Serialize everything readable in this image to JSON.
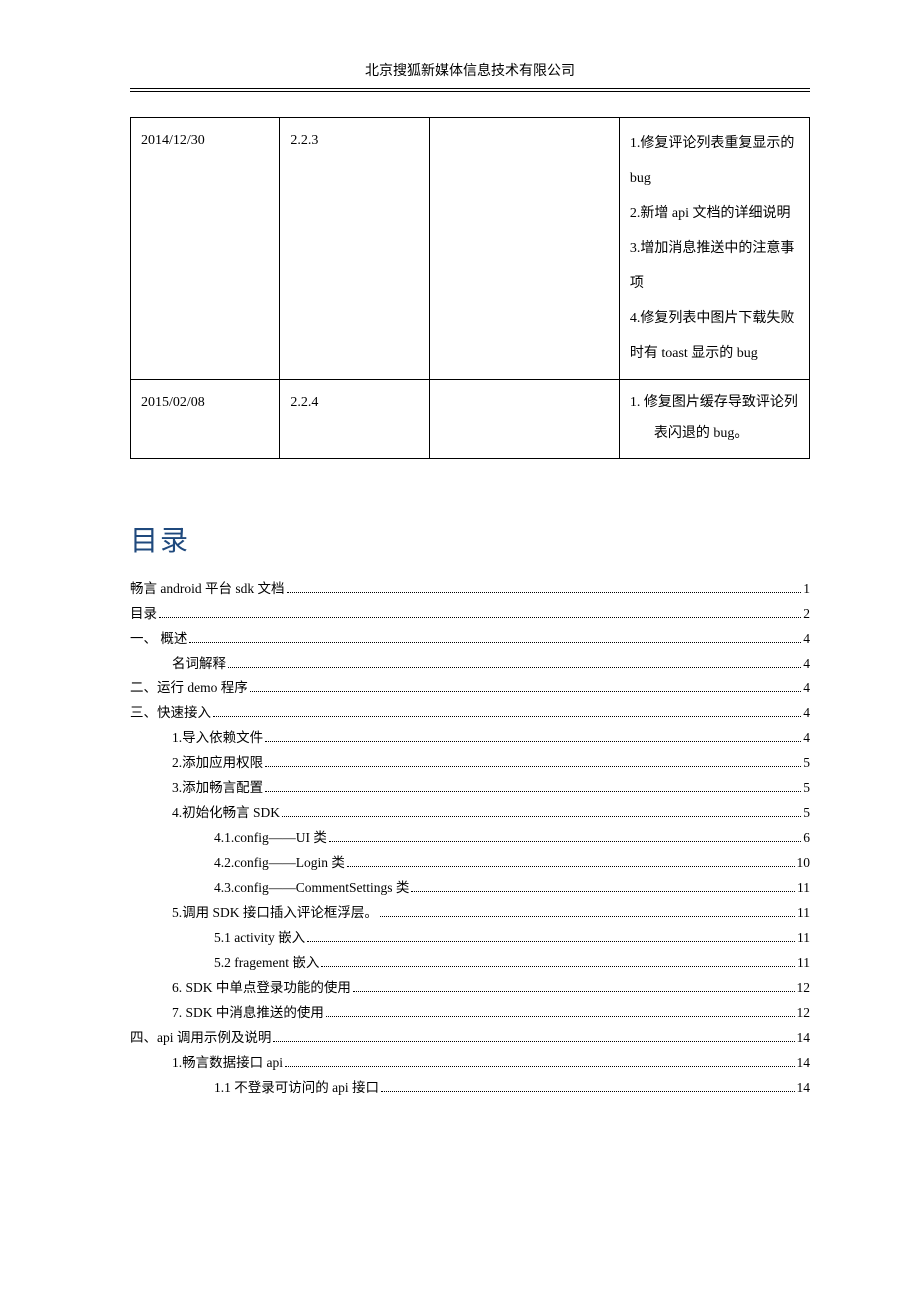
{
  "header": {
    "company": "北京搜狐新媒体信息技术有限公司"
  },
  "table": {
    "rows": [
      {
        "date": "2014/12/30",
        "version": "2.2.3",
        "col3": "",
        "notes": [
          "1.修复评论列表重复显示的 bug",
          "2.新增 api 文档的详细说明",
          "3.增加消息推送中的注意事项",
          "4.修复列表中图片下载失败时有 toast 显示的 bug"
        ],
        "ordered": false
      },
      {
        "date": "2015/02/08",
        "version": "2.2.4",
        "col3": "",
        "notes": [
          "修复图片缓存导致评论列表闪退的 bug。"
        ],
        "ordered": true
      }
    ]
  },
  "toc": {
    "title": "目录",
    "items": [
      {
        "label": "畅言 android 平台 sdk 文档",
        "page": "1",
        "indent": 0
      },
      {
        "label": "目录",
        "page": "2",
        "indent": 0
      },
      {
        "label": "一、 概述",
        "page": "4",
        "indent": 0
      },
      {
        "label": "名词解释",
        "page": "4",
        "indent": 1
      },
      {
        "label": "二、运行 demo 程序",
        "page": "4",
        "indent": 0
      },
      {
        "label": "三、快速接入",
        "page": "4",
        "indent": 0
      },
      {
        "label": "1.导入依赖文件",
        "page": "4",
        "indent": 1
      },
      {
        "label": "2.添加应用权限",
        "page": "5",
        "indent": 1
      },
      {
        "label": "3.添加畅言配置",
        "page": "5",
        "indent": 1
      },
      {
        "label": "4.初始化畅言 SDK",
        "page": "5",
        "indent": 1
      },
      {
        "label": "4.1.config——UI 类",
        "page": "6",
        "indent": 2
      },
      {
        "label": "4.2.config——Login 类",
        "page": "10",
        "indent": 2
      },
      {
        "label": "4.3.config——CommentSettings 类",
        "page": "11",
        "indent": 2
      },
      {
        "label": "5.调用 SDK 接口插入评论框浮层。",
        "page": "11",
        "indent": 1
      },
      {
        "label": "5.1 activity 嵌入",
        "page": "11",
        "indent": 2
      },
      {
        "label": "5.2 fragement 嵌入",
        "page": "11",
        "indent": 2
      },
      {
        "label": "6. SDK 中单点登录功能的使用",
        "page": "12",
        "indent": 1
      },
      {
        "label": "7. SDK 中消息推送的使用",
        "page": "12",
        "indent": 1
      },
      {
        "label": "四、api 调用示例及说明",
        "page": "14",
        "indent": 0
      },
      {
        "label": "1.畅言数据接口 api",
        "page": "14",
        "indent": 1
      },
      {
        "label": "1.1  不登录可访问的 api 接口",
        "page": "14",
        "indent": 2
      }
    ]
  }
}
